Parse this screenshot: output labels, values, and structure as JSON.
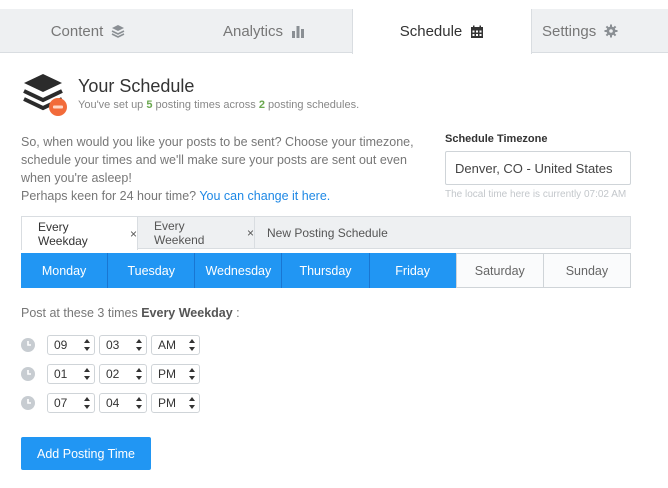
{
  "tabs": [
    {
      "label": "Content",
      "icon": "layers-icon"
    },
    {
      "label": "Analytics",
      "icon": "bar-chart-icon"
    },
    {
      "label": "Schedule",
      "icon": "calendar-icon",
      "active": true
    },
    {
      "label": "Settings",
      "icon": "gear-icon"
    }
  ],
  "header": {
    "title": "Your Schedule",
    "subtitle_prefix": "You've set up ",
    "times_count": "5",
    "subtitle_middle": " posting times across ",
    "schedules_count": "2",
    "subtitle_suffix": " posting schedules."
  },
  "intro": {
    "text": "So, when would you like your posts to be sent? Choose your timezone, schedule your times and we'll make sure your posts are sent out even when you're asleep!",
    "hour_prefix": "Perhaps keen for 24 hour time? ",
    "hour_link": "You can change it here."
  },
  "timezone": {
    "label": "Schedule Timezone",
    "value": "Denver, CO - United States",
    "note": "The local time here is currently 07:02 AM"
  },
  "schedule_tabs": [
    {
      "label": "Every Weekday",
      "closable": true,
      "active": true
    },
    {
      "label": "Every Weekend",
      "closable": true
    },
    {
      "label": "New Posting Schedule",
      "closable": false
    }
  ],
  "close_glyph": "×",
  "days": [
    {
      "label": "Monday",
      "on": true
    },
    {
      "label": "Tuesday",
      "on": true
    },
    {
      "label": "Wednesday",
      "on": true
    },
    {
      "label": "Thursday",
      "on": true
    },
    {
      "label": "Friday",
      "on": true
    },
    {
      "label": "Saturday",
      "on": false
    },
    {
      "label": "Sunday",
      "on": false
    }
  ],
  "post_label": {
    "prefix": "Post at these 3 times ",
    "schedule": "Every Weekday",
    "suffix": " :"
  },
  "times": [
    {
      "hour": "09",
      "minute": "03",
      "ampm": "AM"
    },
    {
      "hour": "01",
      "minute": "02",
      "ampm": "PM"
    },
    {
      "hour": "07",
      "minute": "04",
      "ampm": "PM"
    }
  ],
  "add_button": "Add Posting Time",
  "colors": {
    "accent": "#2196f3",
    "success": "#6aa84f",
    "logo_badge": "#f26b3a"
  }
}
